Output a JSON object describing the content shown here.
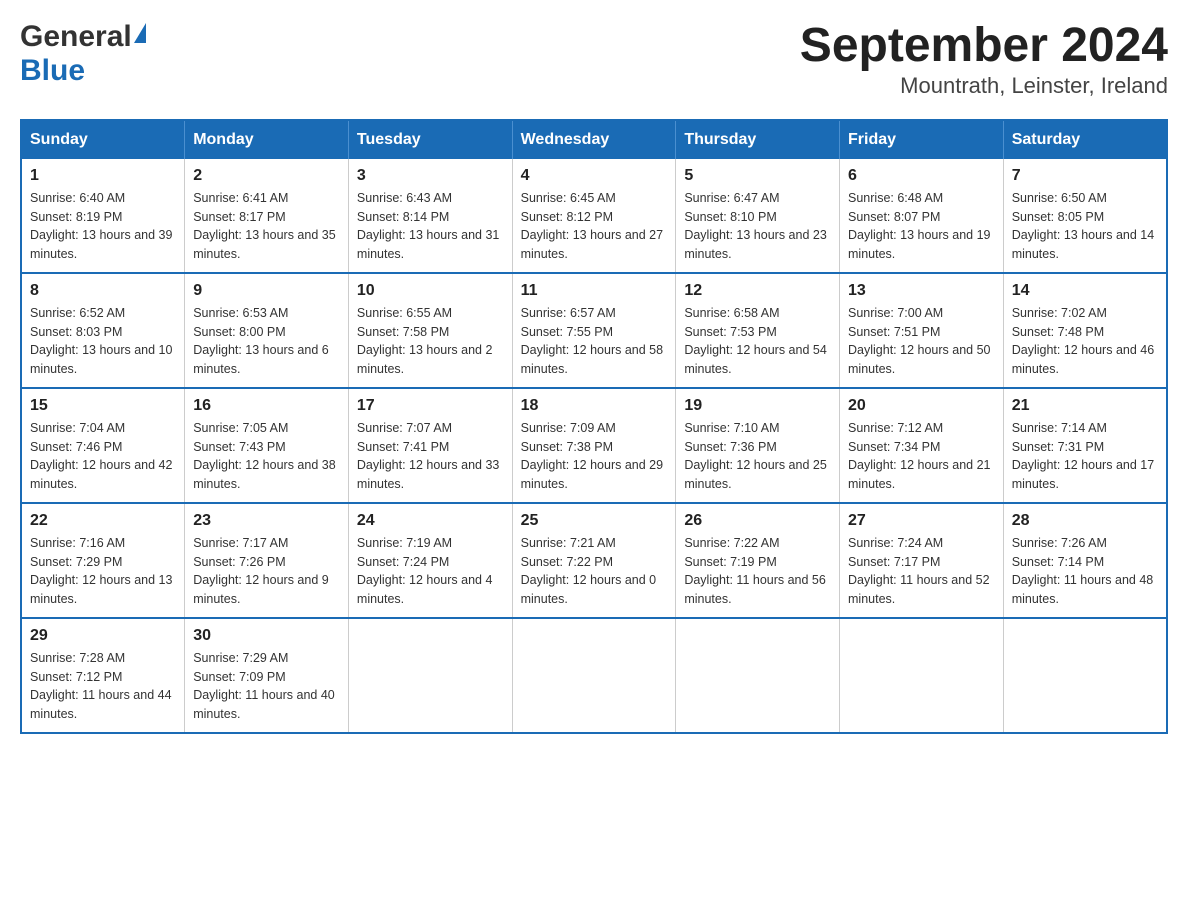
{
  "header": {
    "logo_general": "General",
    "logo_blue": "Blue",
    "title": "September 2024",
    "subtitle": "Mountrath, Leinster, Ireland"
  },
  "calendar": {
    "days_of_week": [
      "Sunday",
      "Monday",
      "Tuesday",
      "Wednesday",
      "Thursday",
      "Friday",
      "Saturday"
    ],
    "weeks": [
      [
        {
          "day": "1",
          "sunrise": "Sunrise: 6:40 AM",
          "sunset": "Sunset: 8:19 PM",
          "daylight": "Daylight: 13 hours and 39 minutes."
        },
        {
          "day": "2",
          "sunrise": "Sunrise: 6:41 AM",
          "sunset": "Sunset: 8:17 PM",
          "daylight": "Daylight: 13 hours and 35 minutes."
        },
        {
          "day": "3",
          "sunrise": "Sunrise: 6:43 AM",
          "sunset": "Sunset: 8:14 PM",
          "daylight": "Daylight: 13 hours and 31 minutes."
        },
        {
          "day": "4",
          "sunrise": "Sunrise: 6:45 AM",
          "sunset": "Sunset: 8:12 PM",
          "daylight": "Daylight: 13 hours and 27 minutes."
        },
        {
          "day": "5",
          "sunrise": "Sunrise: 6:47 AM",
          "sunset": "Sunset: 8:10 PM",
          "daylight": "Daylight: 13 hours and 23 minutes."
        },
        {
          "day": "6",
          "sunrise": "Sunrise: 6:48 AM",
          "sunset": "Sunset: 8:07 PM",
          "daylight": "Daylight: 13 hours and 19 minutes."
        },
        {
          "day": "7",
          "sunrise": "Sunrise: 6:50 AM",
          "sunset": "Sunset: 8:05 PM",
          "daylight": "Daylight: 13 hours and 14 minutes."
        }
      ],
      [
        {
          "day": "8",
          "sunrise": "Sunrise: 6:52 AM",
          "sunset": "Sunset: 8:03 PM",
          "daylight": "Daylight: 13 hours and 10 minutes."
        },
        {
          "day": "9",
          "sunrise": "Sunrise: 6:53 AM",
          "sunset": "Sunset: 8:00 PM",
          "daylight": "Daylight: 13 hours and 6 minutes."
        },
        {
          "day": "10",
          "sunrise": "Sunrise: 6:55 AM",
          "sunset": "Sunset: 7:58 PM",
          "daylight": "Daylight: 13 hours and 2 minutes."
        },
        {
          "day": "11",
          "sunrise": "Sunrise: 6:57 AM",
          "sunset": "Sunset: 7:55 PM",
          "daylight": "Daylight: 12 hours and 58 minutes."
        },
        {
          "day": "12",
          "sunrise": "Sunrise: 6:58 AM",
          "sunset": "Sunset: 7:53 PM",
          "daylight": "Daylight: 12 hours and 54 minutes."
        },
        {
          "day": "13",
          "sunrise": "Sunrise: 7:00 AM",
          "sunset": "Sunset: 7:51 PM",
          "daylight": "Daylight: 12 hours and 50 minutes."
        },
        {
          "day": "14",
          "sunrise": "Sunrise: 7:02 AM",
          "sunset": "Sunset: 7:48 PM",
          "daylight": "Daylight: 12 hours and 46 minutes."
        }
      ],
      [
        {
          "day": "15",
          "sunrise": "Sunrise: 7:04 AM",
          "sunset": "Sunset: 7:46 PM",
          "daylight": "Daylight: 12 hours and 42 minutes."
        },
        {
          "day": "16",
          "sunrise": "Sunrise: 7:05 AM",
          "sunset": "Sunset: 7:43 PM",
          "daylight": "Daylight: 12 hours and 38 minutes."
        },
        {
          "day": "17",
          "sunrise": "Sunrise: 7:07 AM",
          "sunset": "Sunset: 7:41 PM",
          "daylight": "Daylight: 12 hours and 33 minutes."
        },
        {
          "day": "18",
          "sunrise": "Sunrise: 7:09 AM",
          "sunset": "Sunset: 7:38 PM",
          "daylight": "Daylight: 12 hours and 29 minutes."
        },
        {
          "day": "19",
          "sunrise": "Sunrise: 7:10 AM",
          "sunset": "Sunset: 7:36 PM",
          "daylight": "Daylight: 12 hours and 25 minutes."
        },
        {
          "day": "20",
          "sunrise": "Sunrise: 7:12 AM",
          "sunset": "Sunset: 7:34 PM",
          "daylight": "Daylight: 12 hours and 21 minutes."
        },
        {
          "day": "21",
          "sunrise": "Sunrise: 7:14 AM",
          "sunset": "Sunset: 7:31 PM",
          "daylight": "Daylight: 12 hours and 17 minutes."
        }
      ],
      [
        {
          "day": "22",
          "sunrise": "Sunrise: 7:16 AM",
          "sunset": "Sunset: 7:29 PM",
          "daylight": "Daylight: 12 hours and 13 minutes."
        },
        {
          "day": "23",
          "sunrise": "Sunrise: 7:17 AM",
          "sunset": "Sunset: 7:26 PM",
          "daylight": "Daylight: 12 hours and 9 minutes."
        },
        {
          "day": "24",
          "sunrise": "Sunrise: 7:19 AM",
          "sunset": "Sunset: 7:24 PM",
          "daylight": "Daylight: 12 hours and 4 minutes."
        },
        {
          "day": "25",
          "sunrise": "Sunrise: 7:21 AM",
          "sunset": "Sunset: 7:22 PM",
          "daylight": "Daylight: 12 hours and 0 minutes."
        },
        {
          "day": "26",
          "sunrise": "Sunrise: 7:22 AM",
          "sunset": "Sunset: 7:19 PM",
          "daylight": "Daylight: 11 hours and 56 minutes."
        },
        {
          "day": "27",
          "sunrise": "Sunrise: 7:24 AM",
          "sunset": "Sunset: 7:17 PM",
          "daylight": "Daylight: 11 hours and 52 minutes."
        },
        {
          "day": "28",
          "sunrise": "Sunrise: 7:26 AM",
          "sunset": "Sunset: 7:14 PM",
          "daylight": "Daylight: 11 hours and 48 minutes."
        }
      ],
      [
        {
          "day": "29",
          "sunrise": "Sunrise: 7:28 AM",
          "sunset": "Sunset: 7:12 PM",
          "daylight": "Daylight: 11 hours and 44 minutes."
        },
        {
          "day": "30",
          "sunrise": "Sunrise: 7:29 AM",
          "sunset": "Sunset: 7:09 PM",
          "daylight": "Daylight: 11 hours and 40 minutes."
        },
        {
          "day": "",
          "sunrise": "",
          "sunset": "",
          "daylight": ""
        },
        {
          "day": "",
          "sunrise": "",
          "sunset": "",
          "daylight": ""
        },
        {
          "day": "",
          "sunrise": "",
          "sunset": "",
          "daylight": ""
        },
        {
          "day": "",
          "sunrise": "",
          "sunset": "",
          "daylight": ""
        },
        {
          "day": "",
          "sunrise": "",
          "sunset": "",
          "daylight": ""
        }
      ]
    ]
  }
}
